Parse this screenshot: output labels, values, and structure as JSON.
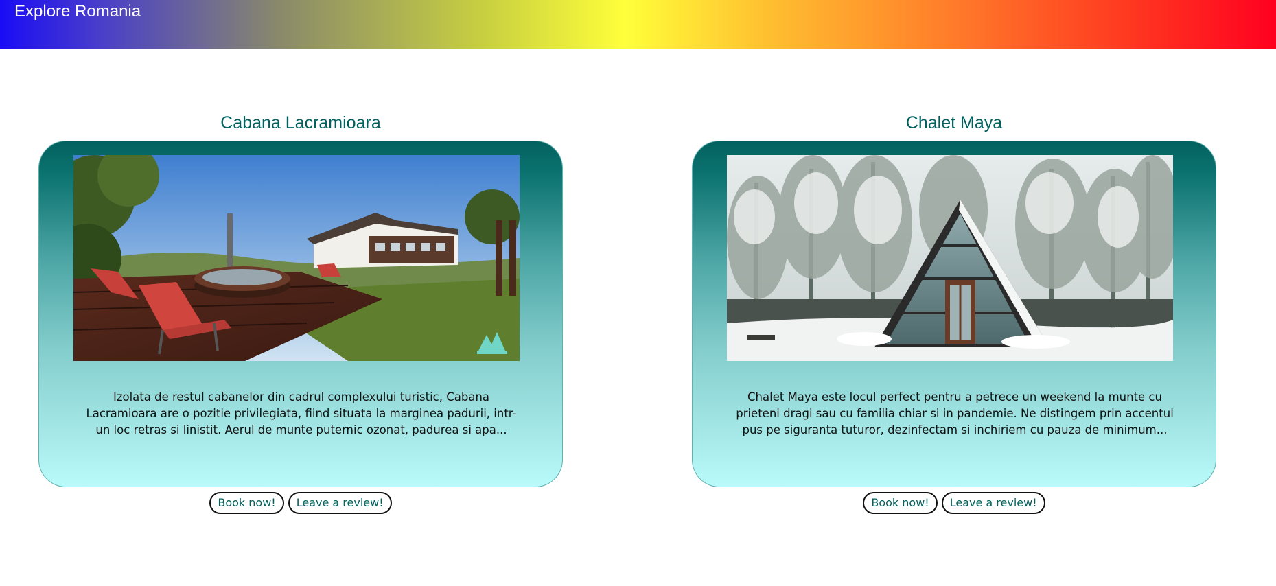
{
  "header": {
    "title": "Explore Romania"
  },
  "cards": [
    {
      "title": "Cabana Lacramioara",
      "description": "Izolata de restul cabanelor din cadrul complexului turistic, Cabana Lacramioara are o pozitie privilegiata, fiind situata la marginea padurii, intr-un loc retras si linistit. Aerul de munte puternic ozonat, padurea si apa...",
      "image": "cabin-with-hot-tub-deck",
      "book_label": "Book now!",
      "review_label": "Leave a review!"
    },
    {
      "title": "Chalet Maya",
      "description": "Chalet Maya este locul perfect pentru a petrece un weekend la munte cu prieteni dragi sau cu familia chiar si in pandemie. Ne distingem prin accentul pus pe siguranta tuturor, dezinfectam si inchiriem cu pauza de minimum...",
      "image": "a-frame-chalet-in-snowy-forest",
      "book_label": "Book now!",
      "review_label": "Leave a review!"
    }
  ],
  "colors": {
    "accent": "#02615e",
    "card_top": "#02615e",
    "card_bottom": "#b8fbfa"
  }
}
